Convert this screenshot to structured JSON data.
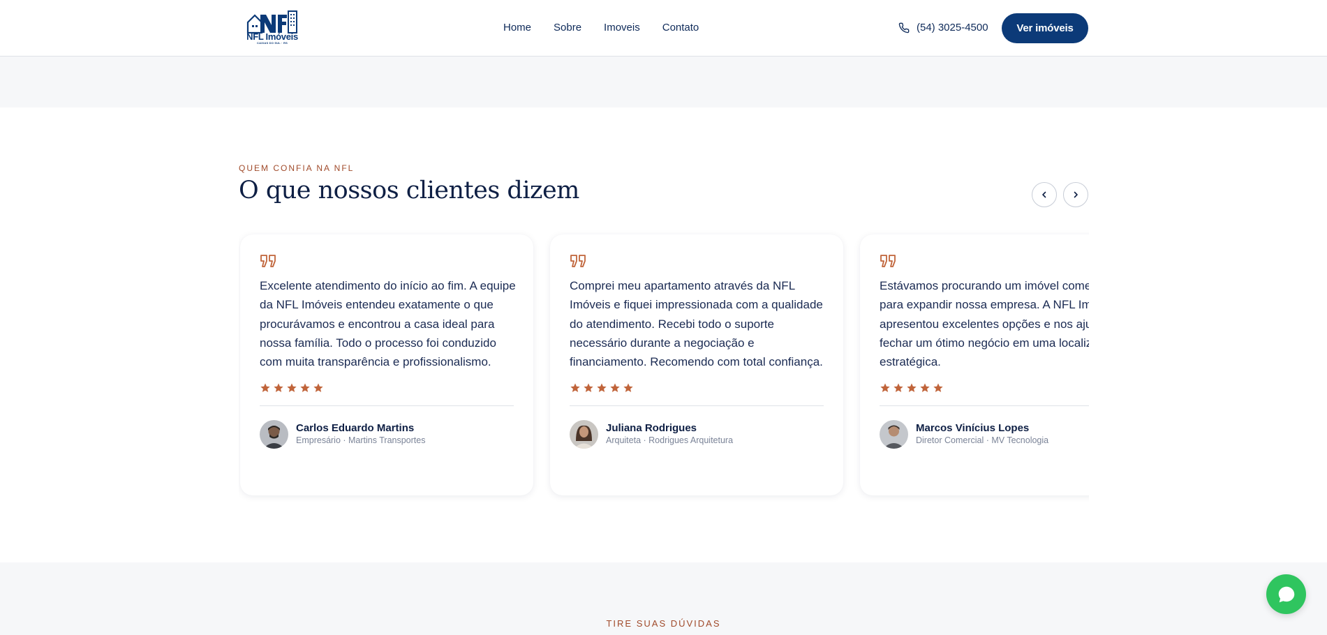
{
  "header": {
    "logo_name": "NFL Imóveis",
    "logo_sub": "CAXIAS DO SUL · RS",
    "nav": [
      "Home",
      "Sobre",
      "Imoveis",
      "Contato"
    ],
    "phone": "(54) 3025-4500",
    "cta": "Ver imóveis"
  },
  "section": {
    "eyebrow": "QUEM CONFIA NA NFL",
    "title": "O que nossos clientes dizem",
    "prev_icon": "chevron-left-icon",
    "next_icon": "chevron-right-icon"
  },
  "testimonials": [
    {
      "text": "Excelente atendimento do início ao fim. A equipe da NFL Imóveis entendeu exatamente o que procurávamos e encontrou a casa ideal para nossa família. Todo o processo foi conduzido com muita transparência e profissionalismo.",
      "rating": 5,
      "name": "Carlos Eduardo Martins",
      "role": "Empresário · Martins Transportes"
    },
    {
      "text": "Comprei meu apartamento através da NFL Imóveis e fiquei impressionada com a qualidade do atendimento. Recebi todo o suporte necessário durante a negociação e financiamento. Recomendo com total confiança.",
      "rating": 5,
      "name": "Juliana Rodrigues",
      "role": "Arquiteta · Rodrigues Arquitetura"
    },
    {
      "text": "Estávamos procurando um imóvel comercial para expandir nossa empresa. A NFL Imóveis apresentou excelentes opções e nos ajudou a fechar um ótimo negócio em uma localização estratégica.",
      "rating": 5,
      "name": "Marcos Vinícius Lopes",
      "role": "Diretor Comercial · MV Tecnologia"
    }
  ],
  "faq": {
    "eyebrow": "TIRE SUAS DÚVIDAS"
  },
  "colors": {
    "brand_navy": "#0c3a78",
    "accent_copper": "#c0643a",
    "whatsapp_green": "#2fc55f"
  }
}
